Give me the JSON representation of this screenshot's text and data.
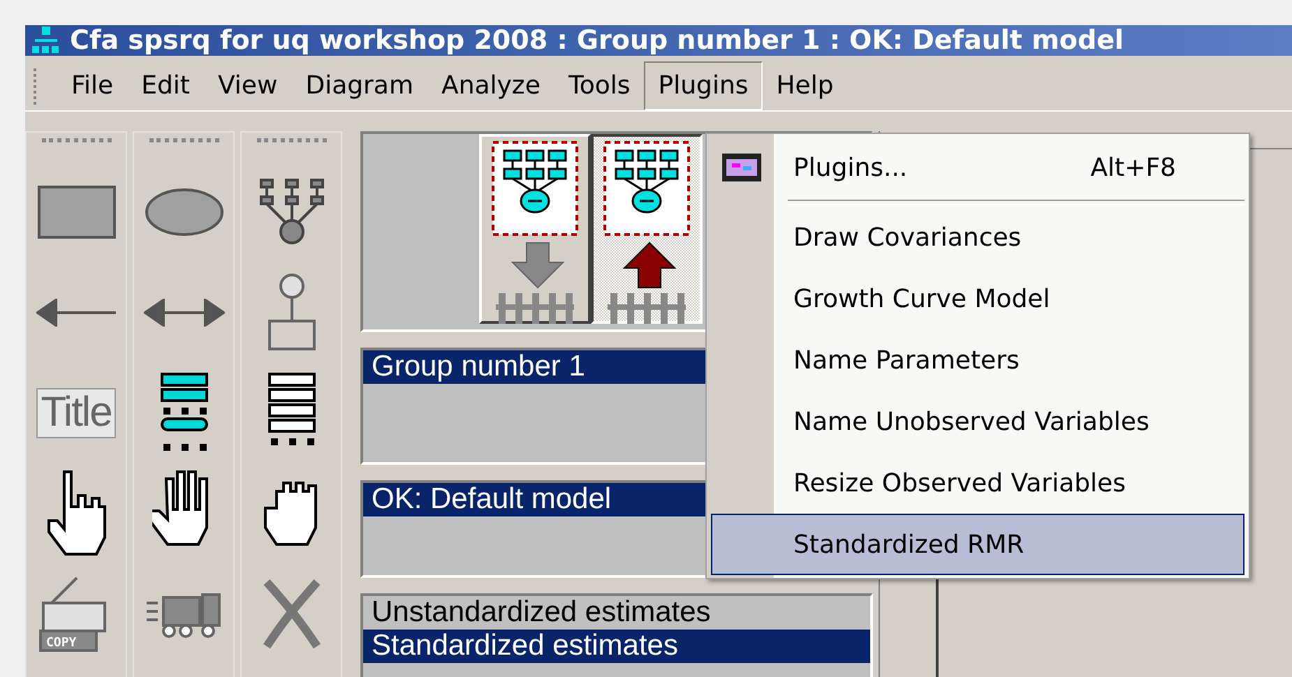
{
  "window": {
    "title": "Cfa spsrq for uq workshop 2008 : Group number 1 : OK: Default model"
  },
  "menu_bar": [
    {
      "label": "File",
      "selected": false
    },
    {
      "label": "Edit",
      "selected": false
    },
    {
      "label": "View",
      "selected": false
    },
    {
      "label": "Diagram",
      "selected": false
    },
    {
      "label": "Analyze",
      "selected": false
    },
    {
      "label": "Tools",
      "selected": false
    },
    {
      "label": "Plugins",
      "selected": true
    },
    {
      "label": "Help",
      "selected": false
    }
  ],
  "toolbox": {
    "title_tool_label": "Title",
    "copy_tool_label": "COPY"
  },
  "view_buttons": [
    {
      "kind": "input",
      "selected": false
    },
    {
      "kind": "output",
      "selected": true
    }
  ],
  "groups": [
    {
      "label": "Group number 1",
      "selected": true
    }
  ],
  "models": [
    {
      "label": "OK: Default model",
      "selected": true
    }
  ],
  "estimates": [
    {
      "label": "Unstandardized estimates",
      "selected": false
    },
    {
      "label": "Standardized estimates",
      "selected": true
    }
  ],
  "plugins_menu": [
    {
      "kind": "command",
      "label": "Plugins...",
      "shortcut": "Alt+F8",
      "selected": false
    },
    {
      "kind": "separator"
    },
    {
      "kind": "item",
      "label": "Draw Covariances",
      "selected": false
    },
    {
      "kind": "item",
      "label": "Growth Curve Model",
      "selected": false
    },
    {
      "kind": "item",
      "label": "Name Parameters",
      "selected": false
    },
    {
      "kind": "item",
      "label": "Name Unobserved Variables",
      "selected": false
    },
    {
      "kind": "item",
      "label": "Resize Observed Variables",
      "selected": false
    },
    {
      "kind": "item",
      "label": "Standardized RMR",
      "selected": true
    }
  ]
}
